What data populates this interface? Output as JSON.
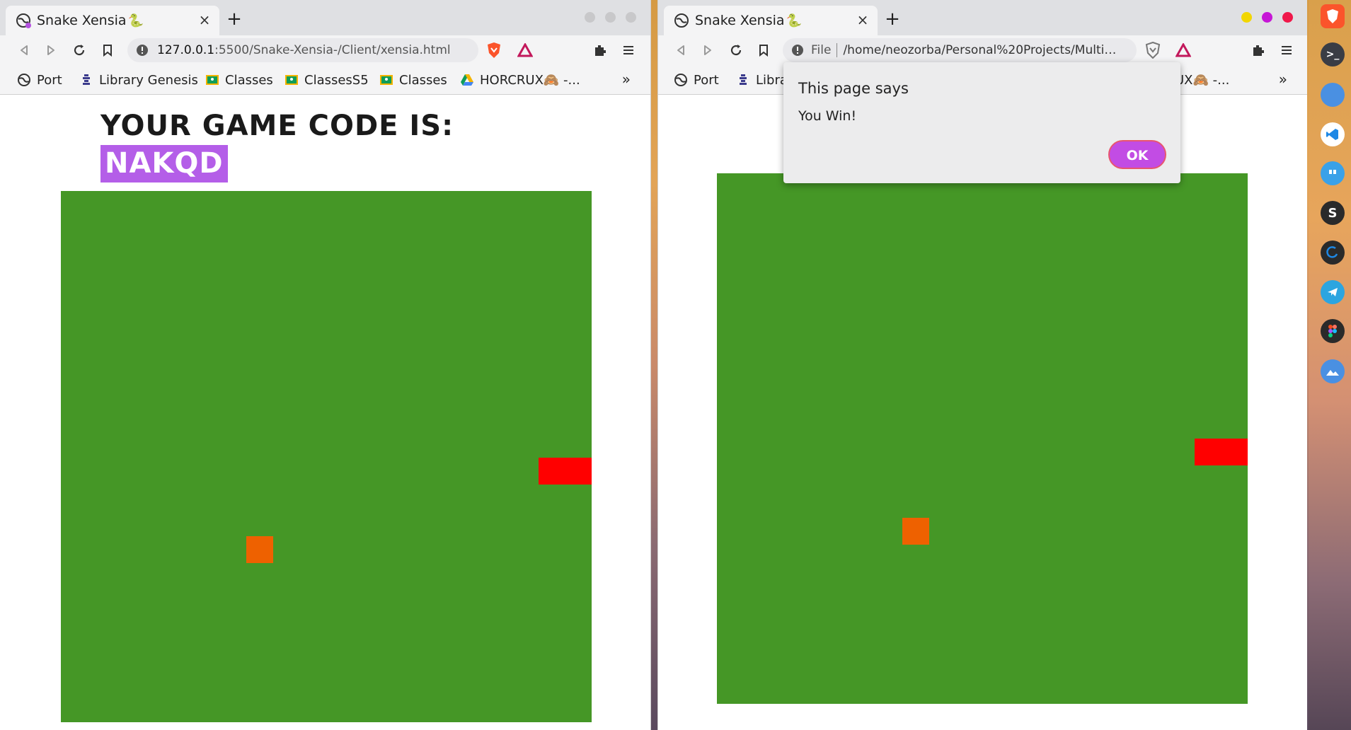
{
  "left_window": {
    "tab_title": "Snake Xensia",
    "tab_emoji": "🐍",
    "new_tab": "+",
    "tab_close": "×",
    "url_host": "127.0.0.1",
    "url_path": ":5500/Snake-Xensia-/Client/xensia.html",
    "bookmarks": [
      "Port",
      "Library Genesis",
      "Classes",
      "ClassesS5",
      "Classes",
      "HORCRUX🙈 -..."
    ],
    "bookmarks_more": "»",
    "heading": "YOUR GAME CODE IS:",
    "game_code": "NAKQD"
  },
  "right_window": {
    "tab_title": "Snake Xensia",
    "tab_emoji": "🐍",
    "new_tab": "+",
    "tab_close": "×",
    "url_label": "File",
    "url_path": "/home/neozorba/Personal%20Projects/Multipl...",
    "bookmarks": [
      "Port",
      "Libra",
      "UX🙈 -..."
    ],
    "bookmarks_more": "»",
    "dialog": {
      "title": "This page says",
      "message": "You Win!",
      "ok_label": "OK"
    }
  },
  "colors": {
    "board": "#459726",
    "food": "#ee6100",
    "snake": "#ff0000",
    "code_highlight": "#b45ee8",
    "dialog_ok": "#c24ce4"
  },
  "dock_icons": [
    "brave-icon",
    "terminal-icon",
    "chrome-icon",
    "vscode-icon",
    "chat-icon",
    "s-app-icon",
    "clock-app-icon",
    "telegram-icon",
    "figma-icon",
    "wallpaper-app-icon"
  ],
  "dock_labels": {
    "terminal": ">_",
    "s_app": "S"
  }
}
